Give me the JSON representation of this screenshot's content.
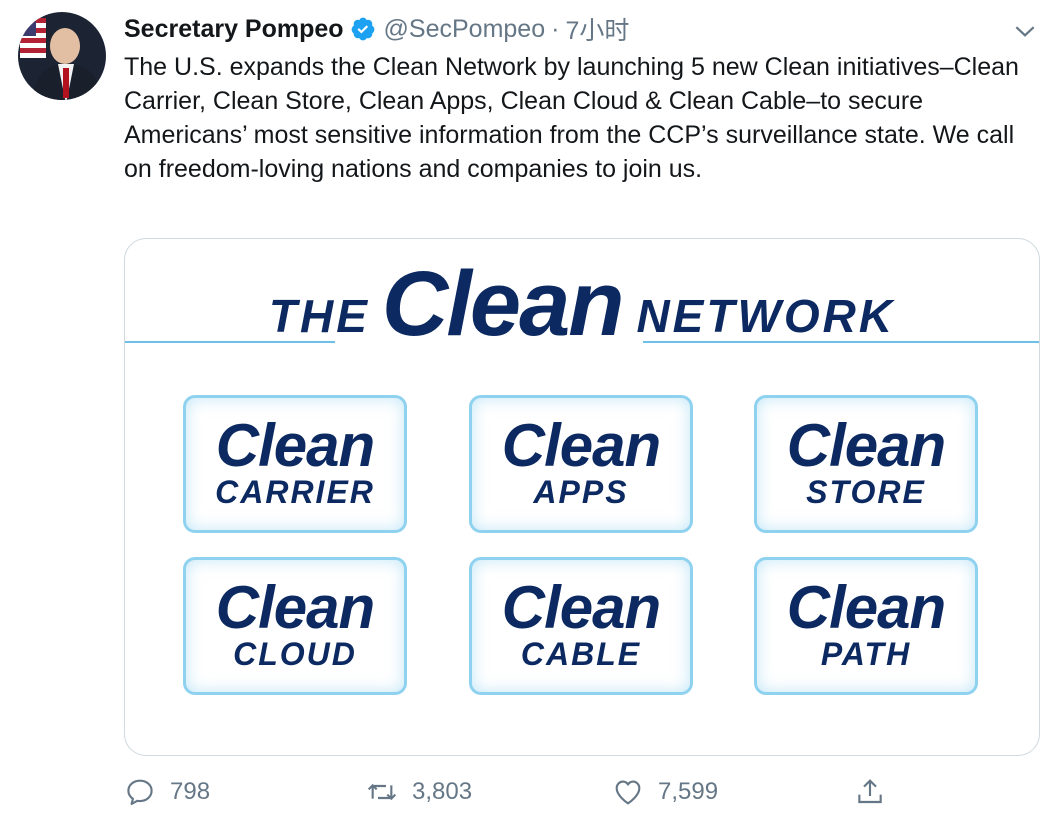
{
  "tweet": {
    "author_name": "Secretary Pompeo",
    "handle": "@SecPompeo",
    "separator": "·",
    "time": "7小时",
    "text": "The U.S. expands the Clean Network by launching 5 new Clean initiatives–Clean Carrier, Clean Store, Clean Apps, Clean Cloud & Clean Cable–to secure Americans’ most sensitive information from the CCP’s surveillance state. We call on freedom-loving nations and companies to join us."
  },
  "card": {
    "banner": {
      "the": "THE",
      "clean": "Clean",
      "network": "NETWORK"
    },
    "tiles": [
      {
        "top": "Clean",
        "bottom": "CARRIER"
      },
      {
        "top": "Clean",
        "bottom": "APPS"
      },
      {
        "top": "Clean",
        "bottom": "STORE"
      },
      {
        "top": "Clean",
        "bottom": "CLOUD"
      },
      {
        "top": "Clean",
        "bottom": "CABLE"
      },
      {
        "top": "Clean",
        "bottom": "PATH"
      }
    ]
  },
  "actions": {
    "replies": "798",
    "retweets": "3,803",
    "likes": "7,599"
  },
  "icons": {
    "verified": "verified-badge-icon",
    "more": "chevron-down-icon",
    "reply": "reply-icon",
    "retweet": "retweet-icon",
    "like": "heart-icon",
    "share": "share-icon"
  },
  "colors": {
    "brand_navy": "#0c2a61",
    "accent_light_blue": "#8fd2f0",
    "verified_blue": "#1da1f2",
    "muted_text": "#657786"
  }
}
